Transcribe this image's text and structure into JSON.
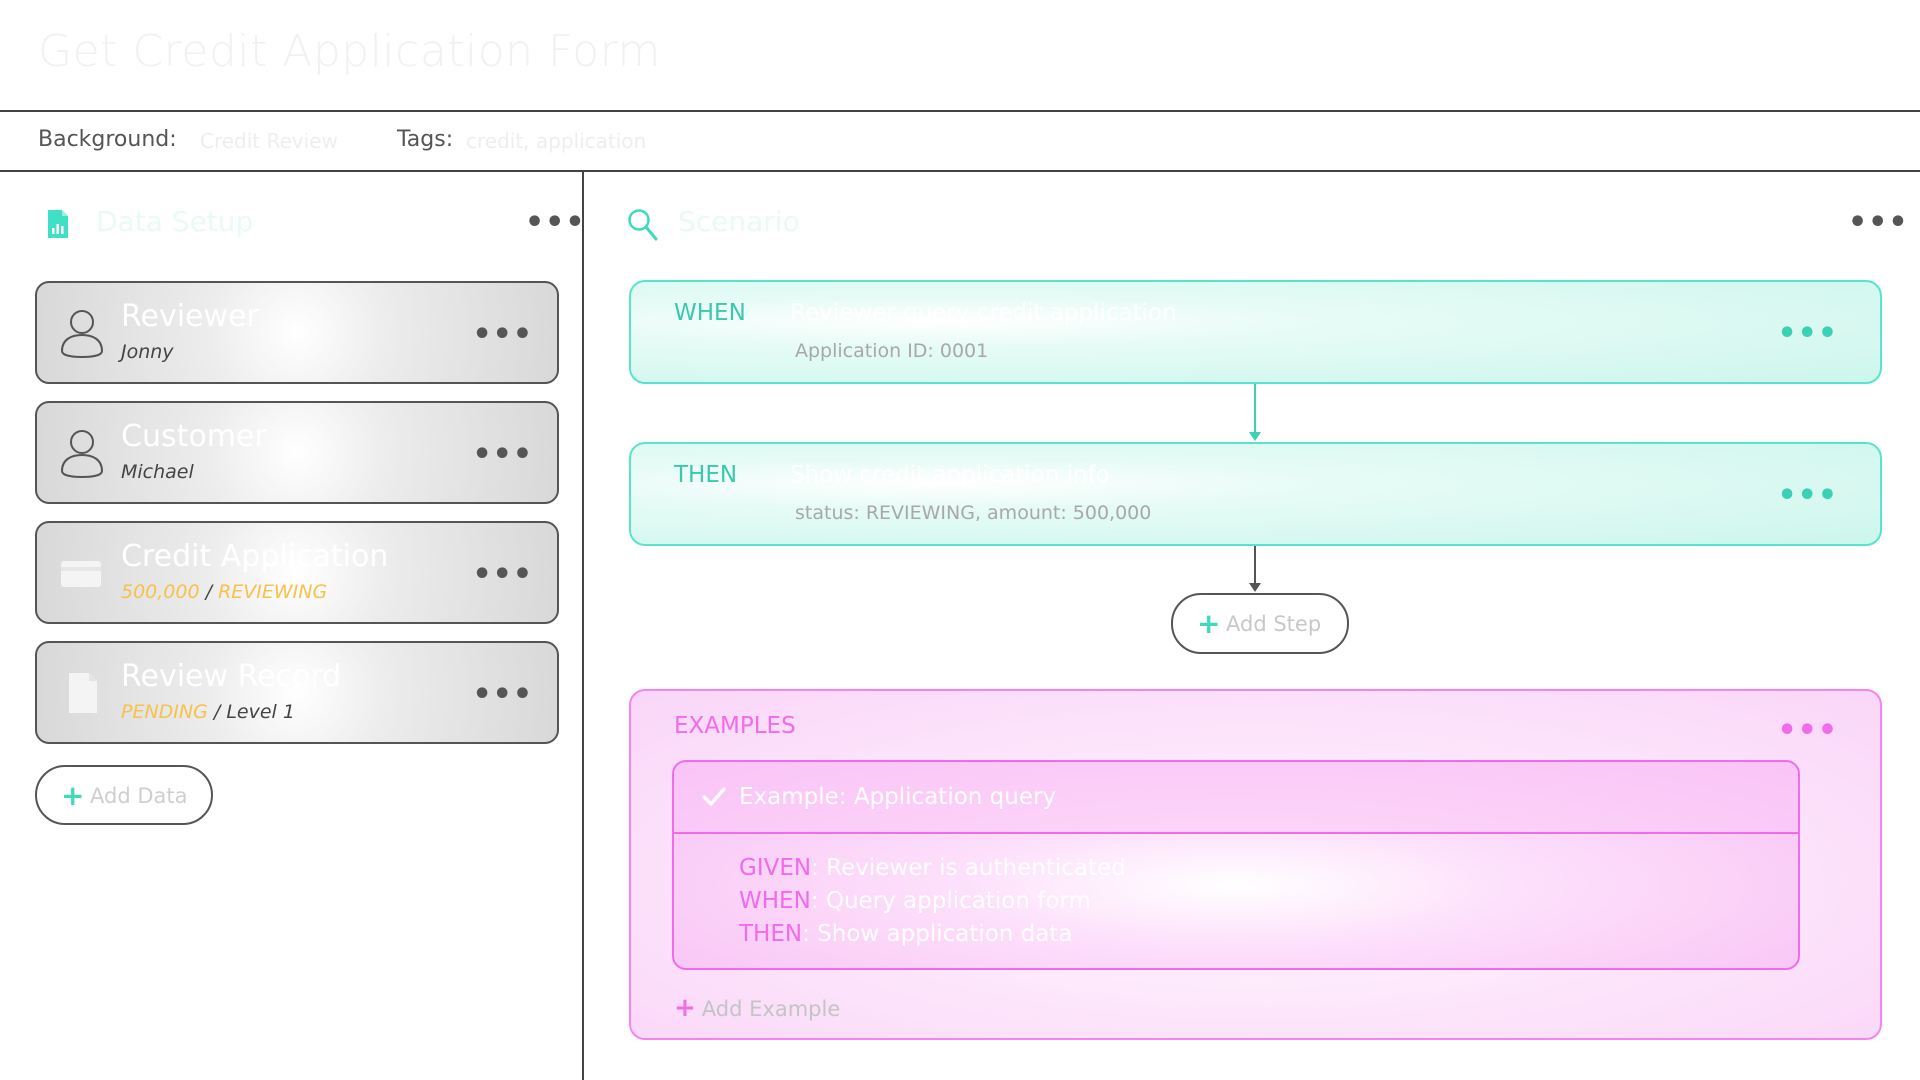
{
  "page": {
    "title": "Get Credit Application Form"
  },
  "meta": {
    "background_label": "Background:",
    "background_value": "Credit Review",
    "tags_label": "Tags:",
    "tags_value": "credit, application"
  },
  "data_panel": {
    "title": "Data Setup",
    "more_label": "•••",
    "cards": [
      {
        "title": "Reviewer",
        "sub": "Jonny",
        "icon": "user-icon"
      },
      {
        "title": "Customer",
        "sub": "Michael",
        "icon": "user-icon"
      },
      {
        "title": "Credit Application",
        "sub_highlight": "500,000",
        "sub_sep": " / ",
        "sub_highlight2": "REVIEWING",
        "icon": "card-icon"
      },
      {
        "title": "Review Record",
        "sub_highlight": "PENDING",
        "sub_sep": " / Level 1",
        "icon": "document-icon"
      }
    ],
    "add_label": "Add Data"
  },
  "scenario_panel": {
    "title": "Scenario",
    "more_label": "•••",
    "steps": [
      {
        "keyword": "WHEN",
        "title": "Reviewer query credit  application",
        "sub": "Application ID: 0001"
      },
      {
        "keyword": "THEN",
        "title": "Show credit application info",
        "sub": "status: REVIEWING, amount: 500,000"
      }
    ],
    "add_step_label": "Add Step"
  },
  "examples": {
    "title": "EXAMPLES",
    "more_label": "•••",
    "example_title": "Example: Application query",
    "lines": [
      {
        "keyword": "GIVEN",
        "text": ": Reviewer is authenticated"
      },
      {
        "keyword": "WHEN",
        "text": ": Query application form"
      },
      {
        "keyword": "THEN",
        "text": ": Show application data"
      }
    ],
    "add_label": "Add Example"
  },
  "colors": {
    "teal": "#3ac9ac",
    "pink": "#f06ce8",
    "amber": "#f7c14b"
  }
}
